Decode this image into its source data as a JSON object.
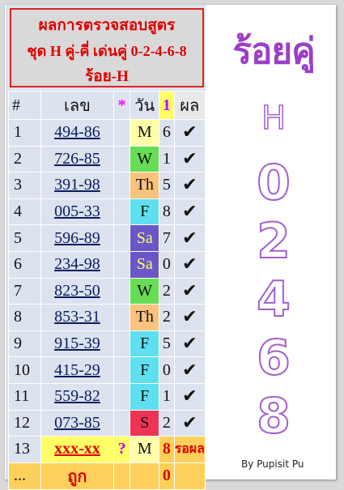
{
  "title": {
    "line1": "ผลการตรวจสอบสูตร",
    "line2": "ชุด H คู่-คี่ เด่นคู่ 0-2-4-6-8",
    "line3": "ร้อย-H"
  },
  "big_title": "ร้อยคู่",
  "big_list": [
    "H",
    "0",
    "2",
    "4",
    "6",
    "8"
  ],
  "credit": "By Pupisit Pu",
  "header": {
    "num": "#",
    "lek": "เลข",
    "star": "*",
    "day": "วัน",
    "one": "1",
    "res": "ผล"
  },
  "rows": [
    {
      "n": "1",
      "lek": "494-86",
      "day": "M",
      "day_color": "#ffffaa",
      "d": "6",
      "res": "✔"
    },
    {
      "n": "2",
      "lek": "726-85",
      "day": "W",
      "day_color": "#66dd55",
      "d": "1",
      "res": "✔"
    },
    {
      "n": "3",
      "lek": "391-98",
      "day": "Th",
      "day_color": "#f9c27d",
      "d": "5",
      "res": "✔"
    },
    {
      "n": "4",
      "lek": "005-33",
      "day": "F",
      "day_color": "#5fe0f0",
      "d": "8",
      "res": "✔"
    },
    {
      "n": "5",
      "lek": "596-89",
      "day": "Sa",
      "day_color": "#6a56c8",
      "day_text": "#ffff66",
      "d": "7",
      "res": "✔"
    },
    {
      "n": "6",
      "lek": "234-98",
      "day": "Sa",
      "day_color": "#6a56c8",
      "day_text": "#ffff66",
      "d": "0",
      "res": "✔"
    },
    {
      "n": "7",
      "lek": "823-50",
      "day": "W",
      "day_color": "#66dd55",
      "d": "2",
      "res": "✔"
    },
    {
      "n": "8",
      "lek": "853-31",
      "day": "Th",
      "day_color": "#f9c27d",
      "d": "2",
      "res": "✔"
    },
    {
      "n": "9",
      "lek": "915-39",
      "day": "F",
      "day_color": "#5fe0f0",
      "d": "5",
      "res": "✔"
    },
    {
      "n": "10",
      "lek": "415-29",
      "day": "F",
      "day_color": "#5fe0f0",
      "d": "0",
      "res": "✔"
    },
    {
      "n": "11",
      "lek": "559-82",
      "day": "F",
      "day_color": "#5fe0f0",
      "d": "1",
      "res": "✔"
    },
    {
      "n": "12",
      "lek": "073-85",
      "day": "S",
      "day_color": "#ee3355",
      "d": "2",
      "res": "✔"
    }
  ],
  "pending": {
    "n": "13",
    "lek": "xxx-xx",
    "q": "?",
    "day": "M",
    "d": "8",
    "res": "รอผล"
  },
  "footer": {
    "n": "...",
    "lek": "ถูก",
    "d": "0"
  }
}
